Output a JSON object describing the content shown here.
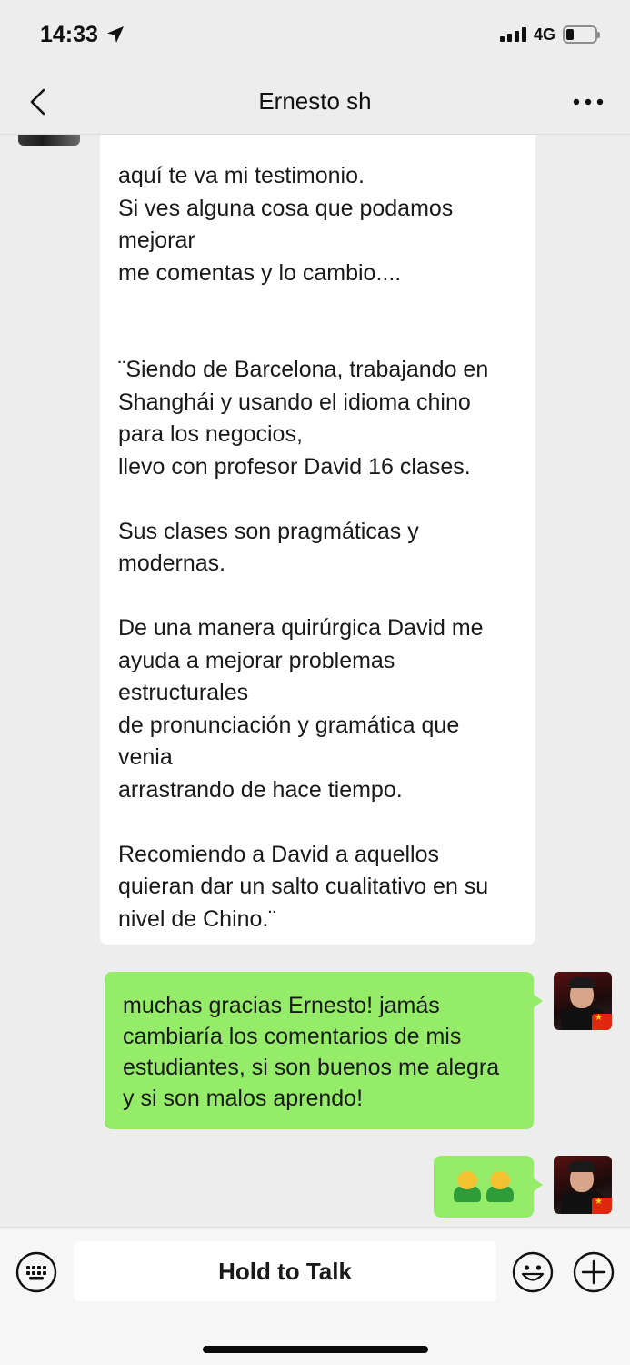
{
  "status_bar": {
    "time": "14:33",
    "network": "4G",
    "battery_level": 0.25
  },
  "nav": {
    "title": "Ernesto sh",
    "back_icon": "chevron-left-icon",
    "more_icon": "more-dots-icon"
  },
  "messages": [
    {
      "side": "left",
      "text": "aquí te va mi testimonio.\nSi ves alguna cosa que podamos mejorar\nme comentas y lo cambio....\n\n\n¨Siendo de Barcelona, trabajando en Shanghái y usando el idioma chino para los negocios,\nllevo con profesor David 16 clases.\n\nSus clases son pragmáticas y modernas.\n\nDe una manera quirúrgica David me ayuda a mejorar problemas estructurales\nde pronunciación y gramática que venia\narrastrando de hace tiempo.\n\nRecomiendo a David a aquellos quieran dar un salto cualitativo en su nivel de Chino.¨"
    },
    {
      "side": "right",
      "text": "muchas gracias Ernesto! jamás cambiaría los comentarios de mis estudiantes, si son buenos me alegra y si son malos aprendo!"
    },
    {
      "side": "right",
      "emoji": [
        "hugging-person-emoji",
        "hugging-person-emoji"
      ]
    }
  ],
  "input_bar": {
    "hold_to_talk": "Hold to Talk",
    "keyboard_icon": "keyboard-icon",
    "emoji_icon": "smiley-icon",
    "plus_icon": "plus-circle-icon"
  },
  "colors": {
    "background": "#ededed",
    "sent_bubble": "#95ec69",
    "received_bubble": "#ffffff"
  }
}
